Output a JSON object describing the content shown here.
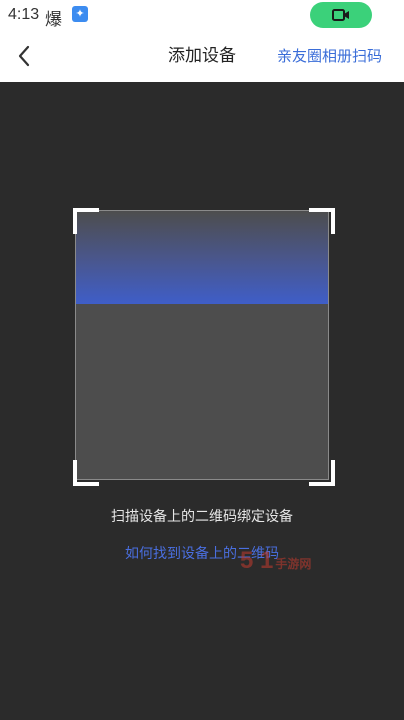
{
  "status_bar": {
    "time": "4:13",
    "app_glyph": "爆",
    "app_icon": "badge-icon",
    "video_icon": "video-camera-icon"
  },
  "nav": {
    "back_icon": "chevron-left-icon",
    "title": "添加设备",
    "action": "亲友圈相册扫码"
  },
  "scanner": {
    "accent_color": "#3f5ec8",
    "hint": "扫描设备上的二维码绑定设备",
    "help_link": "如何找到设备上的二维码"
  },
  "watermark": {
    "brand": "5 1",
    "suffix": "手游网"
  }
}
